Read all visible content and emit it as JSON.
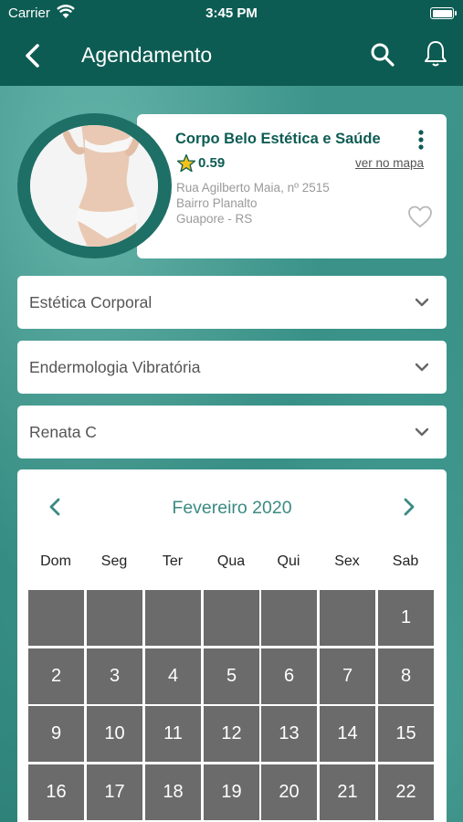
{
  "status_bar": {
    "carrier": "Carrier",
    "time": "3:45 PM"
  },
  "nav": {
    "title": "Agendamento"
  },
  "clinic": {
    "name": "Corpo Belo Estética e Saúde",
    "rating": "0.59",
    "map_link": "ver no mapa",
    "address_line1": "Rua Agilberto Maia, nº 2515",
    "address_line2": "Bairro Planalto",
    "address_line3": "Guapore - RS"
  },
  "selects": [
    {
      "value": "Estética Corporal"
    },
    {
      "value": "Endermologia Vibratória"
    },
    {
      "value": "Renata C"
    }
  ],
  "calendar": {
    "month_label": "Fevereiro 2020",
    "weekdays": [
      "Dom",
      "Seg",
      "Ter",
      "Qua",
      "Qui",
      "Sex",
      "Sab"
    ],
    "rows": [
      [
        "",
        "",
        "",
        "",
        "",
        "",
        "1"
      ],
      [
        "2",
        "3",
        "4",
        "5",
        "6",
        "7",
        "8"
      ],
      [
        "9",
        "10",
        "11",
        "12",
        "13",
        "14",
        "15"
      ],
      [
        "16",
        "17",
        "18",
        "19",
        "20",
        "21",
        "22"
      ]
    ]
  },
  "colors": {
    "primary": "#0d5c53",
    "accent": "#3b8a82",
    "day_cell": "#6b6b6b",
    "star": "#f2c21b"
  }
}
